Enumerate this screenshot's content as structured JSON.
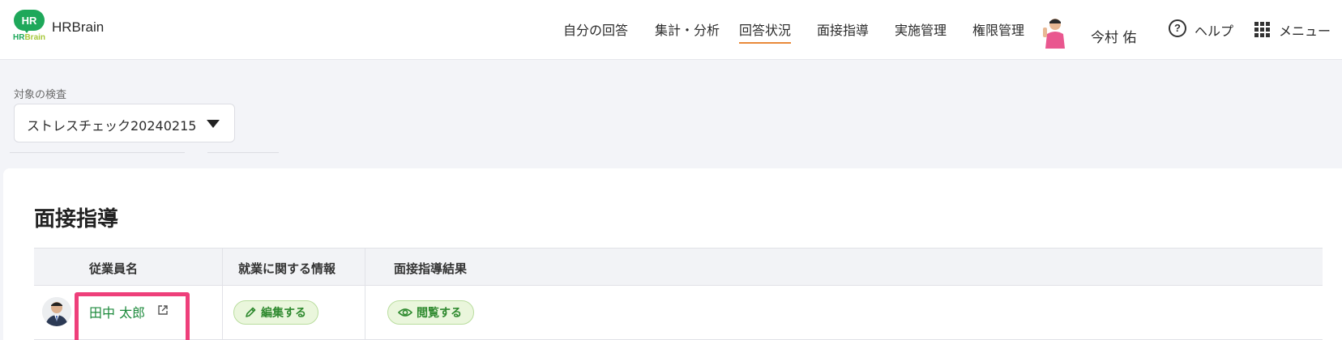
{
  "header": {
    "logo_text": "HR",
    "logo_sub_hr": "HR",
    "logo_sub_brain": "Brain",
    "brand": "HRBrain",
    "nav": [
      {
        "label": "自分の回答"
      },
      {
        "label": "集計・分析"
      },
      {
        "label": "回答状況",
        "active": true
      },
      {
        "label": "面接指導"
      },
      {
        "label": "実施管理"
      },
      {
        "label": "権限管理"
      }
    ],
    "user_name": "今村 佑",
    "help_label": "ヘルプ",
    "help_icon_text": "?",
    "menu_label": "メニュー"
  },
  "filter": {
    "label": "対象の検査",
    "selected": "ストレスチェック20240215"
  },
  "section": {
    "title": "面接指導"
  },
  "table": {
    "headers": [
      "従業員名",
      "就業に関する情報",
      "面接指導結果"
    ],
    "rows": [
      {
        "employee_name": "田中 太郎",
        "edit_label": "編集する",
        "view_label": "閲覧する"
      }
    ]
  },
  "colors": {
    "brand_green": "#1ea85a",
    "active_underline": "#e98a3a",
    "highlight": "#ee3f7a",
    "link_green": "#1d8a3c",
    "pill_bg": "#eaf6dc"
  },
  "icons": [
    "help-circle-icon",
    "grid-menu-icon",
    "external-link-icon",
    "pencil-icon",
    "eye-icon",
    "caret-down-icon"
  ]
}
